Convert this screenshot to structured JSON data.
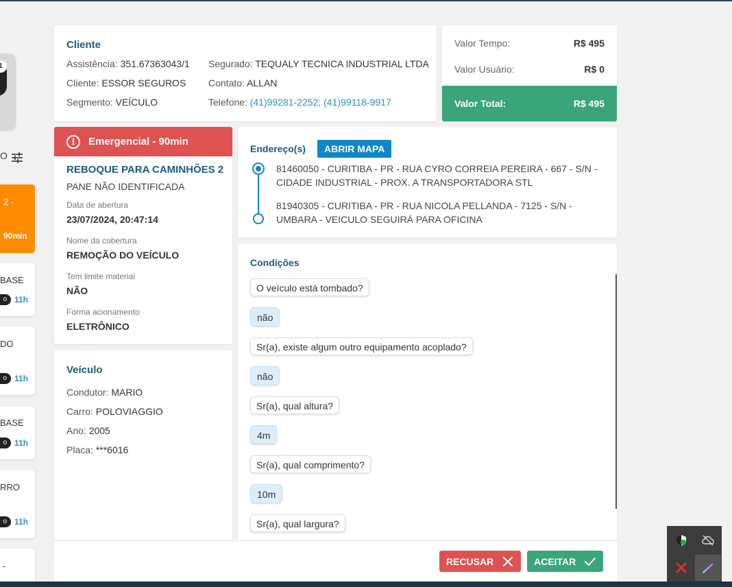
{
  "sidebar": {
    "badge": "1",
    "filter_partial": "O",
    "orange_card": {
      "line1": "2 -",
      "line2": "90min"
    },
    "cards": [
      {
        "title": "BASE",
        "badge": "o",
        "time": "11h"
      },
      {
        "title": "DO",
        "badge": "o",
        "time": "11h"
      },
      {
        "title": "BASE",
        "badge": "o",
        "time": "11h"
      },
      {
        "title": "RRO",
        "badge": "o",
        "time": "11h"
      },
      {
        "title": "-"
      }
    ]
  },
  "cliente": {
    "title": "Cliente",
    "assistencia_label": "Assistência:",
    "assistencia": "351.67363043/1",
    "cliente_label": "Cliente:",
    "cliente": "ESSOR SEGUROS",
    "segmento_label": "Segmento:",
    "segmento": "VEÍCULO",
    "segurado_label": "Segurado:",
    "segurado": "TEQUALY TECNICA INDUSTRIAL LTDA",
    "contato_label": "Contato:",
    "contato": "ALLAN",
    "telefone_label": "Telefone:",
    "telefone": "(41)99281-2252; (41)99118-9917"
  },
  "valores": {
    "tempo_label": "Valor Tempo:",
    "tempo": "R$ 495",
    "usuario_label": "Valor Usuário:",
    "usuario": "R$ 0",
    "total_label": "Valor Total:",
    "total": "R$ 495"
  },
  "servico": {
    "emergencia": "Emergencial - 90min",
    "tipo": "REBOQUE PARA CAMINHÕES 2",
    "problema": "PANE NÃO IDENTIFICADA",
    "abertura_label": "Data de abertura",
    "abertura": "23/07/2024, 20:47:14",
    "cobertura_label": "Nome da cobertura",
    "cobertura": "REMOÇÃO DO VEÍCULO",
    "limite_label": "Tem limite material",
    "limite": "NÃO",
    "acionamento_label": "Forma acionamento",
    "acionamento": "ELETRÔNICO"
  },
  "enderecos": {
    "title": "Endereço(s)",
    "map_button": "ABRIR MAPA",
    "origem": "81460050 - CURITIBA - PR - RUA CYRO CORREIA PEREIRA - 667 - S/N - CIDADE INDUSTRIAL - PROX. A TRANSPORTADORA STL",
    "destino": "81940305 - CURITIBA - PR - RUA NICOLA PELLANDA - 7125 - S/N - UMBARA - VEICULO SEGUIRÁ PARA OFICINA"
  },
  "veiculo": {
    "title": "Veículo",
    "condutor_label": "Condutor:",
    "condutor": "MARIO",
    "carro_label": "Carro:",
    "carro": "POLOVIAGGIO",
    "ano_label": "Ano:",
    "ano": "2005",
    "placa_label": "Placa:",
    "placa": "***6016"
  },
  "condicoes": {
    "title": "Condições",
    "items": [
      {
        "q": "O veículo está tombado?",
        "a": "não"
      },
      {
        "q": "Sr(a), existe algum outro equipamento acoplado?",
        "a": "não"
      },
      {
        "q": "Sr(a), qual altura?",
        "a": "4m"
      },
      {
        "q": "Sr(a), qual comprimento?",
        "a": "10m"
      },
      {
        "q": "Sr(a), qual largura?"
      }
    ]
  },
  "actions": {
    "recusar": "RECUSAR",
    "aceitar": "ACEITAR"
  },
  "colors": {
    "primary": "#1e5a7e",
    "emergency": "#df5252",
    "success": "#3aa57a",
    "accent": "#0e86c9",
    "orange": "#ff8c00"
  }
}
